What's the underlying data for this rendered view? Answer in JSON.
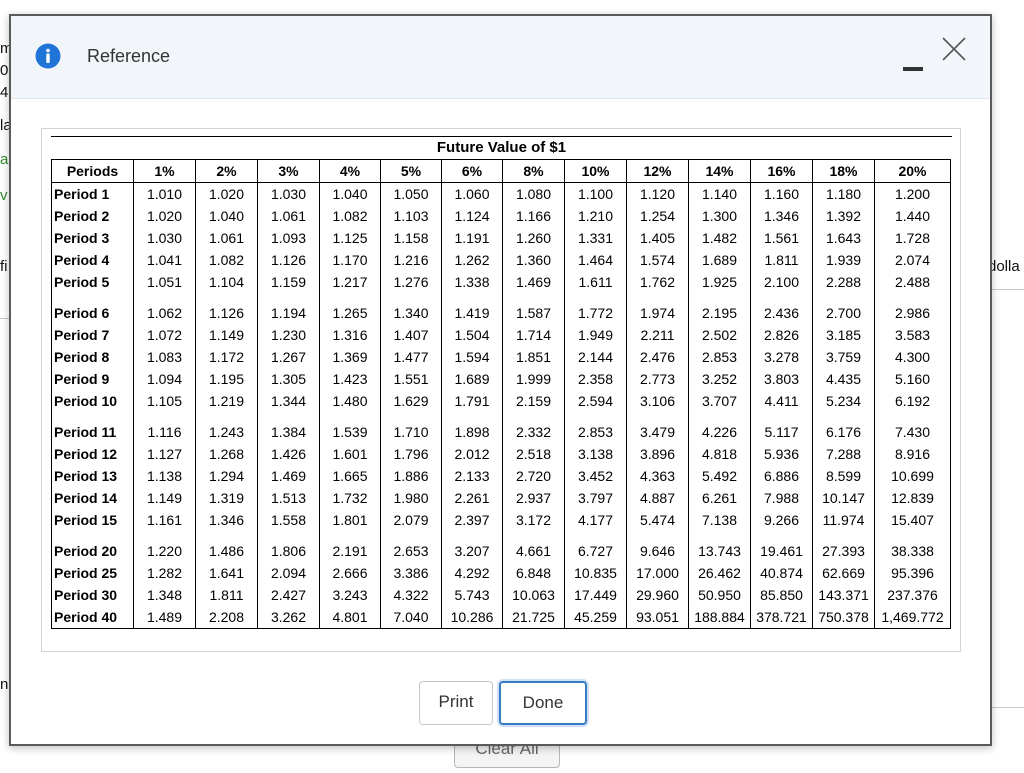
{
  "background": {
    "left_fragments": [
      "m",
      "0",
      "4",
      "la",
      "al",
      "v",
      "fi",
      "n"
    ],
    "right_fragment": "dolla",
    "bottom_button_label": "Clear All"
  },
  "dialog": {
    "title": "Reference",
    "info_icon": "info-icon",
    "minimize_icon": "minimize-icon",
    "close_icon": "close-icon",
    "accent_color": "#1f74d6"
  },
  "table": {
    "caption": "Future Value of $1",
    "header": [
      "Periods",
      "1%",
      "2%",
      "3%",
      "4%",
      "5%",
      "6%",
      "8%",
      "10%",
      "12%",
      "14%",
      "16%",
      "18%",
      "20%"
    ],
    "groups": [
      [
        {
          "period": "Period 1",
          "values": [
            "1.010",
            "1.020",
            "1.030",
            "1.040",
            "1.050",
            "1.060",
            "1.080",
            "1.100",
            "1.120",
            "1.140",
            "1.160",
            "1.180",
            "1.200"
          ]
        },
        {
          "period": "Period 2",
          "values": [
            "1.020",
            "1.040",
            "1.061",
            "1.082",
            "1.103",
            "1.124",
            "1.166",
            "1.210",
            "1.254",
            "1.300",
            "1.346",
            "1.392",
            "1.440"
          ]
        },
        {
          "period": "Period 3",
          "values": [
            "1.030",
            "1.061",
            "1.093",
            "1.125",
            "1.158",
            "1.191",
            "1.260",
            "1.331",
            "1.405",
            "1.482",
            "1.561",
            "1.643",
            "1.728"
          ]
        },
        {
          "period": "Period 4",
          "values": [
            "1.041",
            "1.082",
            "1.126",
            "1.170",
            "1.216",
            "1.262",
            "1.360",
            "1.464",
            "1.574",
            "1.689",
            "1.811",
            "1.939",
            "2.074"
          ]
        },
        {
          "period": "Period 5",
          "values": [
            "1.051",
            "1.104",
            "1.159",
            "1.217",
            "1.276",
            "1.338",
            "1.469",
            "1.611",
            "1.762",
            "1.925",
            "2.100",
            "2.288",
            "2.488"
          ]
        }
      ],
      [
        {
          "period": "Period 6",
          "values": [
            "1.062",
            "1.126",
            "1.194",
            "1.265",
            "1.340",
            "1.419",
            "1.587",
            "1.772",
            "1.974",
            "2.195",
            "2.436",
            "2.700",
            "2.986"
          ]
        },
        {
          "period": "Period 7",
          "values": [
            "1.072",
            "1.149",
            "1.230",
            "1.316",
            "1.407",
            "1.504",
            "1.714",
            "1.949",
            "2.211",
            "2.502",
            "2.826",
            "3.185",
            "3.583"
          ]
        },
        {
          "period": "Period 8",
          "values": [
            "1.083",
            "1.172",
            "1.267",
            "1.369",
            "1.477",
            "1.594",
            "1.851",
            "2.144",
            "2.476",
            "2.853",
            "3.278",
            "3.759",
            "4.300"
          ]
        },
        {
          "period": "Period 9",
          "values": [
            "1.094",
            "1.195",
            "1.305",
            "1.423",
            "1.551",
            "1.689",
            "1.999",
            "2.358",
            "2.773",
            "3.252",
            "3.803",
            "4.435",
            "5.160"
          ]
        },
        {
          "period": "Period 10",
          "values": [
            "1.105",
            "1.219",
            "1.344",
            "1.480",
            "1.629",
            "1.791",
            "2.159",
            "2.594",
            "3.106",
            "3.707",
            "4.411",
            "5.234",
            "6.192"
          ]
        }
      ],
      [
        {
          "period": "Period 11",
          "values": [
            "1.116",
            "1.243",
            "1.384",
            "1.539",
            "1.710",
            "1.898",
            "2.332",
            "2.853",
            "3.479",
            "4.226",
            "5.117",
            "6.176",
            "7.430"
          ]
        },
        {
          "period": "Period 12",
          "values": [
            "1.127",
            "1.268",
            "1.426",
            "1.601",
            "1.796",
            "2.012",
            "2.518",
            "3.138",
            "3.896",
            "4.818",
            "5.936",
            "7.288",
            "8.916"
          ]
        },
        {
          "period": "Period 13",
          "values": [
            "1.138",
            "1.294",
            "1.469",
            "1.665",
            "1.886",
            "2.133",
            "2.720",
            "3.452",
            "4.363",
            "5.492",
            "6.886",
            "8.599",
            "10.699"
          ]
        },
        {
          "period": "Period 14",
          "values": [
            "1.149",
            "1.319",
            "1.513",
            "1.732",
            "1.980",
            "2.261",
            "2.937",
            "3.797",
            "4.887",
            "6.261",
            "7.988",
            "10.147",
            "12.839"
          ]
        },
        {
          "period": "Period 15",
          "values": [
            "1.161",
            "1.346",
            "1.558",
            "1.801",
            "2.079",
            "2.397",
            "3.172",
            "4.177",
            "5.474",
            "7.138",
            "9.266",
            "11.974",
            "15.407"
          ]
        }
      ],
      [
        {
          "period": "Period 20",
          "values": [
            "1.220",
            "1.486",
            "1.806",
            "2.191",
            "2.653",
            "3.207",
            "4.661",
            "6.727",
            "9.646",
            "13.743",
            "19.461",
            "27.393",
            "38.338"
          ]
        },
        {
          "period": "Period 25",
          "values": [
            "1.282",
            "1.641",
            "2.094",
            "2.666",
            "3.386",
            "4.292",
            "6.848",
            "10.835",
            "17.000",
            "26.462",
            "40.874",
            "62.669",
            "95.396"
          ]
        },
        {
          "period": "Period 30",
          "values": [
            "1.348",
            "1.811",
            "2.427",
            "3.243",
            "4.322",
            "5.743",
            "10.063",
            "17.449",
            "29.960",
            "50.950",
            "85.850",
            "143.371",
            "237.376"
          ]
        },
        {
          "period": "Period 40",
          "values": [
            "1.489",
            "2.208",
            "3.262",
            "4.801",
            "7.040",
            "10.286",
            "21.725",
            "45.259",
            "93.051",
            "188.884",
            "378.721",
            "750.378",
            "1,469.772"
          ]
        }
      ]
    ]
  },
  "buttons": {
    "print_label": "Print",
    "done_label": "Done"
  }
}
